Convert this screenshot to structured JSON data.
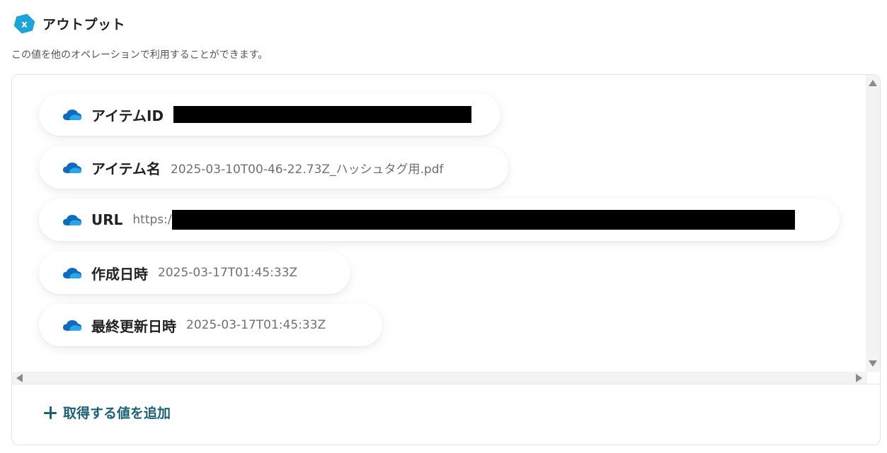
{
  "header": {
    "title": "アウトプット",
    "logo_letter": "x"
  },
  "subtitle": "この値を他のオペレーションで利用することができます。",
  "items": [
    {
      "label": "アイテムID",
      "value": "",
      "redacted": true
    },
    {
      "label": "アイテム名",
      "value": "2025-03-10T00-46-22.73Z_ハッシュタグ用.pdf",
      "redacted": false
    },
    {
      "label": "URL",
      "value": "https:/",
      "redacted": true
    },
    {
      "label": "作成日時",
      "value": "2025-03-17T01:45:33Z",
      "redacted": false
    },
    {
      "label": "最終更新日時",
      "value": "2025-03-17T01:45:33Z",
      "redacted": false
    }
  ],
  "add_button": {
    "label": "取得する値を追加"
  },
  "colors": {
    "accent": "#1d5f73",
    "logo": "#1fa3d9",
    "cloud": "#0f6cbd"
  }
}
